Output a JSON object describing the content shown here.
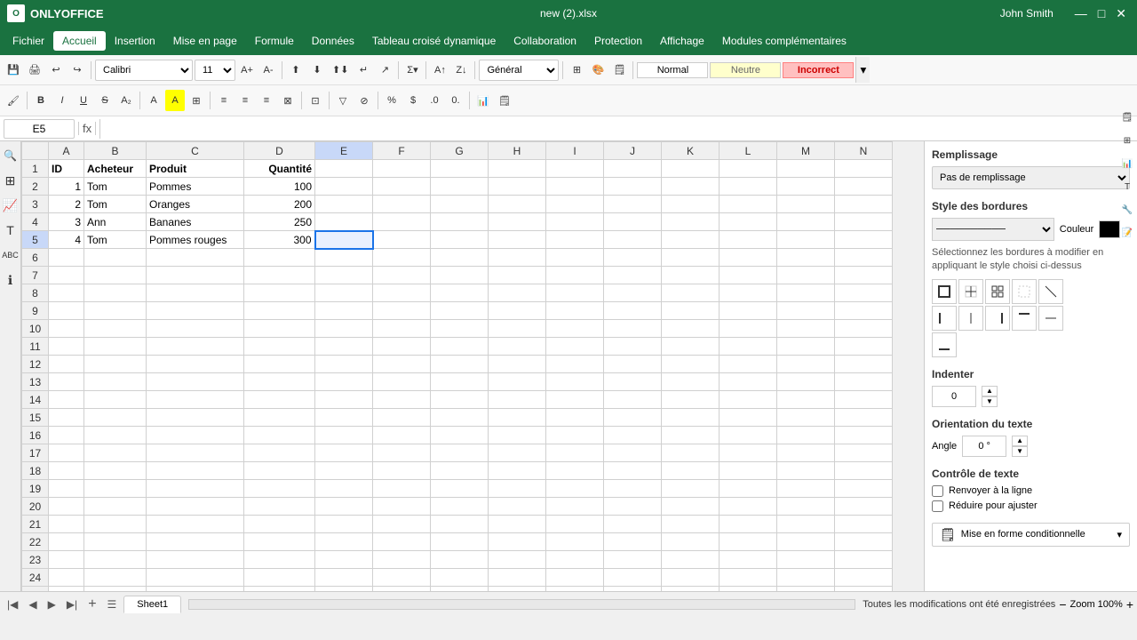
{
  "app": {
    "name": "ONLYOFFICE",
    "filename": "new (2).xlsx",
    "user": "John Smith"
  },
  "menubar": {
    "items": [
      "Fichier",
      "Accueil",
      "Insertion",
      "Mise en page",
      "Formule",
      "Données",
      "Tableau croisé dynamique",
      "Collaboration",
      "Protection",
      "Affichage",
      "Modules complémentaires"
    ],
    "active": "Accueil"
  },
  "toolbar": {
    "font": "Calibri",
    "font_size": "11",
    "cell_ref": "E5",
    "formula": ""
  },
  "cell_styles": {
    "normal": "Normal",
    "neutre": "Neutre",
    "incorrect": "Incorrect"
  },
  "sheet": {
    "columns": [
      "A",
      "B",
      "C",
      "D",
      "E",
      "F",
      "G",
      "H",
      "I",
      "J",
      "K",
      "L",
      "M",
      "N"
    ],
    "headers": [
      "ID",
      "Acheteur",
      "Produit",
      "Quantité",
      "",
      "",
      "",
      "",
      "",
      "",
      "",
      "",
      "",
      ""
    ],
    "rows": [
      {
        "num": 2,
        "a": "1",
        "b": "Tom",
        "c": "Pommes",
        "d": "100",
        "e": ""
      },
      {
        "num": 3,
        "a": "2",
        "b": "Tom",
        "c": "Oranges",
        "d": "200",
        "e": ""
      },
      {
        "num": 4,
        "a": "3",
        "b": "Ann",
        "c": "Bananes",
        "d": "250",
        "e": ""
      },
      {
        "num": 5,
        "a": "4",
        "b": "Tom",
        "c": "Pommes rouges",
        "d": "300",
        "e": ""
      }
    ],
    "selected_cell": "E5",
    "name": "Sheet1"
  },
  "right_panel": {
    "remplissage_label": "Remplissage",
    "remplissage_value": "Pas de remplissage",
    "style_bordures_label": "Style des bordures",
    "couleur_label": "Couleur",
    "border_text": "Sélectionnez les bordures à modifier en appliquant le style choisi ci-dessus",
    "indenter_label": "Indenter",
    "indent_value": "0",
    "orientation_label": "Orientation du texte",
    "angle_label": "Angle",
    "angle_value": "0 °",
    "controle_label": "Contrôle de texte",
    "renvoyer_label": "Renvoyer à la ligne",
    "reduire_label": "Réduire pour ajuster",
    "mise_en_forme_label": "Mise en forme conditionnelle"
  },
  "statusbar": {
    "message": "Toutes les modifications ont été enregistrées",
    "zoom": "Zoom 100%"
  }
}
